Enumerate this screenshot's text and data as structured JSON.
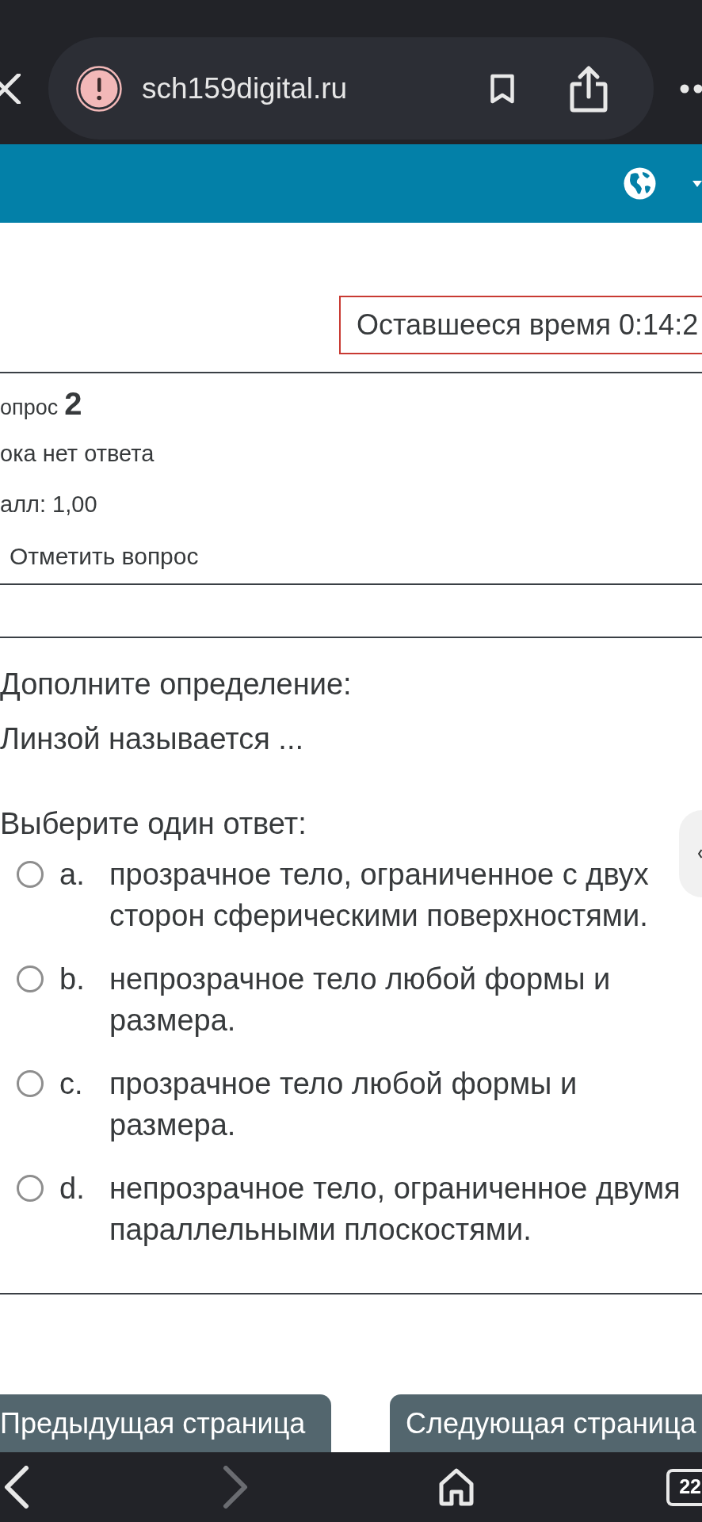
{
  "browser": {
    "url": "sch159digital.ru",
    "nav": {
      "back": {
        "disabled": false
      },
      "forward": {
        "disabled": true
      }
    },
    "tab_count": "22"
  },
  "timer": {
    "text": "Оставшееся время 0:14:2"
  },
  "question_info": {
    "label": "опрос",
    "number": "2",
    "status": "ока нет ответа",
    "grade": "алл: 1,00",
    "flag": "Отметить вопрос"
  },
  "question": {
    "prompt": "Дополните определение:",
    "text": "Линзой называется ...",
    "instruction": "Выберите один ответ:",
    "options": [
      {
        "letter": "a.",
        "text": "прозрачное тело, ограниченное с двух сторон сферическими поверхностями.",
        "selected": false
      },
      {
        "letter": "b.",
        "text": "непрозрачное тело любой формы и размера.",
        "selected": false
      },
      {
        "letter": "c.",
        "text": "прозрачное тело любой формы и размера.",
        "selected": false
      },
      {
        "letter": "d.",
        "text": "непрозрачное тело, ограниченное двумя параллельными плоскостями.",
        "selected": false
      }
    ]
  },
  "page_nav": {
    "previous": "Предыдущая страница",
    "next": "Следующая страница"
  }
}
